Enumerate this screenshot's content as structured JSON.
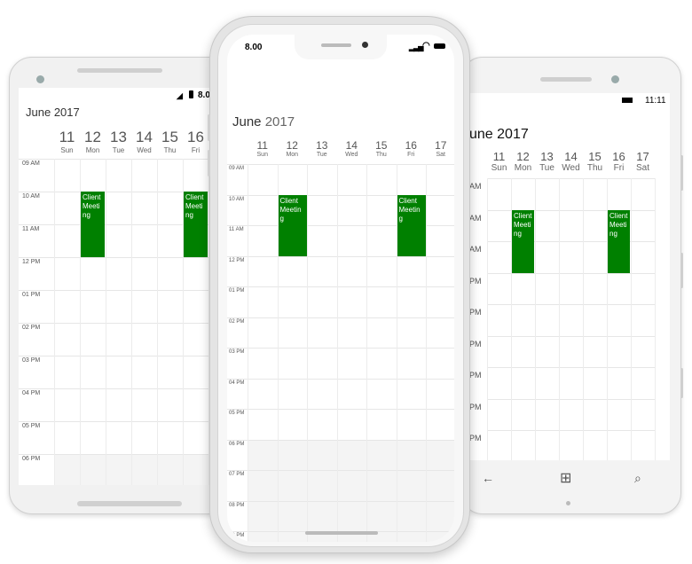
{
  "calendar": {
    "month_title": "June",
    "year": "2017",
    "days": [
      {
        "num": "11",
        "name": "Sun"
      },
      {
        "num": "12",
        "name": "Mon"
      },
      {
        "num": "13",
        "name": "Tue"
      },
      {
        "num": "14",
        "name": "Wed"
      },
      {
        "num": "15",
        "name": "Thu"
      },
      {
        "num": "16",
        "name": "Fri"
      },
      {
        "num": "17",
        "name": "Sat"
      }
    ],
    "appointment_subject": "Client Meeting",
    "appointment_color": "#008000"
  },
  "android": {
    "status_time": "8.0",
    "hours": [
      "09 AM",
      "10 AM",
      "11 AM",
      "12 PM",
      "01 PM",
      "02 PM",
      "03 PM",
      "04 PM",
      "05 PM",
      "06 PM"
    ]
  },
  "iphone": {
    "status_time": "8.00",
    "hours": [
      "09 AM",
      "10 AM",
      "11 AM",
      "12 PM",
      "01 PM",
      "02 PM",
      "03 PM",
      "04 PM",
      "05 PM",
      "06 PM",
      "07 PM",
      "08 PM",
      "09 PM"
    ]
  },
  "winphone": {
    "status_time": "11:11",
    "month_title_partial": "une 2017",
    "hours": [
      "AM",
      "AM",
      "AM",
      "PM",
      "PM",
      "PM",
      "PM",
      "PM",
      "PM"
    ],
    "nav": {
      "back": "←",
      "home": "⊞",
      "search": "⌕"
    }
  }
}
